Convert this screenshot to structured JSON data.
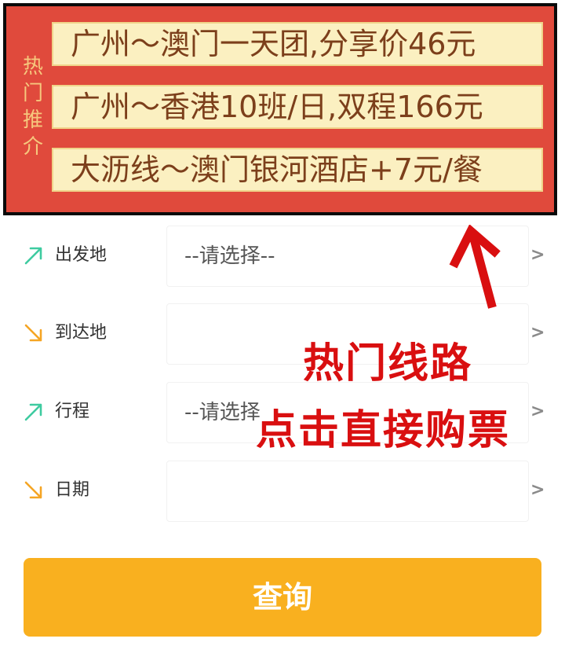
{
  "banner": {
    "label": "热门推介",
    "items": [
      "广州～澳门一天团,分享价46元",
      "广州～香港10班/日,双程166元",
      "大沥线～澳门银河酒店+7元/餐"
    ]
  },
  "form": {
    "rows": [
      {
        "label": "出发地",
        "value": "--请选择--",
        "icon": "arrow-up-right-icon",
        "icon_color": "#3ecba0"
      },
      {
        "label": "到达地",
        "value": "",
        "icon": "arrow-down-right-icon",
        "icon_color": "#f5a524"
      },
      {
        "label": "行程",
        "value": "--请选择",
        "icon": "arrow-up-right-icon",
        "icon_color": "#3ecba0"
      },
      {
        "label": "日期",
        "value": "",
        "icon": "arrow-down-right-icon",
        "icon_color": "#f5a524"
      }
    ],
    "chevron": ">"
  },
  "overlay": {
    "line1": "热门线路",
    "line2": "点击直接购票",
    "color": "#d90f10"
  },
  "query_button": {
    "label": "查询",
    "color": "#f9b01f"
  },
  "colors": {
    "banner_bg": "#e04a3c",
    "banner_item_bg": "#fbf0c1",
    "banner_item_text": "#7c3f1b",
    "banner_label": "#f6c77d"
  }
}
